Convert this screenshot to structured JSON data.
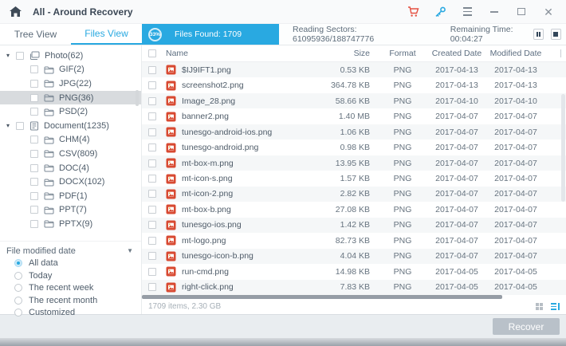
{
  "window": {
    "title": "All - Around Recovery"
  },
  "tabs": {
    "tree": "Tree View",
    "files": "Files View"
  },
  "progress": {
    "percent": "33%",
    "files_found": "Files Found: 1709",
    "reading_sectors": "Reading Sectors: 61095936/188747776",
    "remaining_time": "Remaining Time: 00:04:27"
  },
  "sidebar": {
    "tree": [
      {
        "label": "Photo(62)",
        "icon": "photo",
        "level": 0,
        "expanded": true,
        "selected": false
      },
      {
        "label": "GIF(2)",
        "icon": "folder",
        "level": 1,
        "selected": false
      },
      {
        "label": "JPG(22)",
        "icon": "folder",
        "level": 1,
        "selected": false
      },
      {
        "label": "PNG(36)",
        "icon": "folder",
        "level": 1,
        "selected": true
      },
      {
        "label": "PSD(2)",
        "icon": "folder",
        "level": 1,
        "selected": false
      },
      {
        "label": "Document(1235)",
        "icon": "document",
        "level": 0,
        "expanded": true,
        "selected": false
      },
      {
        "label": "CHM(4)",
        "icon": "folder",
        "level": 1,
        "selected": false
      },
      {
        "label": "CSV(809)",
        "icon": "folder",
        "level": 1,
        "selected": false
      },
      {
        "label": "DOC(4)",
        "icon": "folder",
        "level": 1,
        "selected": false
      },
      {
        "label": "DOCX(102)",
        "icon": "folder",
        "level": 1,
        "selected": false
      },
      {
        "label": "PDF(1)",
        "icon": "folder",
        "level": 1,
        "selected": false
      },
      {
        "label": "PPT(7)",
        "icon": "folder",
        "level": 1,
        "selected": false
      },
      {
        "label": "PPTX(9)",
        "icon": "folder",
        "level": 1,
        "selected": false
      }
    ],
    "filter": {
      "title": "File modified date",
      "options": [
        {
          "label": "All data",
          "selected": true
        },
        {
          "label": "Today",
          "selected": false
        },
        {
          "label": "The recent week",
          "selected": false
        },
        {
          "label": "The recent month",
          "selected": false
        },
        {
          "label": "Customized",
          "selected": false
        }
      ]
    }
  },
  "table": {
    "columns": [
      "Name",
      "Size",
      "Format",
      "Created Date",
      "Modified Date"
    ],
    "rows": [
      {
        "name": "$IJ9IFT1.png",
        "size": "0.53 KB",
        "format": "PNG",
        "created": "2017-04-13",
        "modified": "2017-04-13"
      },
      {
        "name": "screenshot2.png",
        "size": "364.78 KB",
        "format": "PNG",
        "created": "2017-04-13",
        "modified": "2017-04-13"
      },
      {
        "name": "Image_28.png",
        "size": "58.66 KB",
        "format": "PNG",
        "created": "2017-04-10",
        "modified": "2017-04-10"
      },
      {
        "name": "banner2.png",
        "size": "1.40 MB",
        "format": "PNG",
        "created": "2017-04-07",
        "modified": "2017-04-07"
      },
      {
        "name": "tunesgo-android-ios.png",
        "size": "1.06 KB",
        "format": "PNG",
        "created": "2017-04-07",
        "modified": "2017-04-07"
      },
      {
        "name": "tunesgo-android.png",
        "size": "0.98 KB",
        "format": "PNG",
        "created": "2017-04-07",
        "modified": "2017-04-07"
      },
      {
        "name": "mt-box-m.png",
        "size": "13.95 KB",
        "format": "PNG",
        "created": "2017-04-07",
        "modified": "2017-04-07"
      },
      {
        "name": "mt-icon-s.png",
        "size": "1.57 KB",
        "format": "PNG",
        "created": "2017-04-07",
        "modified": "2017-04-07"
      },
      {
        "name": "mt-icon-2.png",
        "size": "2.82 KB",
        "format": "PNG",
        "created": "2017-04-07",
        "modified": "2017-04-07"
      },
      {
        "name": "mt-box-b.png",
        "size": "27.08 KB",
        "format": "PNG",
        "created": "2017-04-07",
        "modified": "2017-04-07"
      },
      {
        "name": "tunesgo-ios.png",
        "size": "1.42 KB",
        "format": "PNG",
        "created": "2017-04-07",
        "modified": "2017-04-07"
      },
      {
        "name": "mt-logo.png",
        "size": "82.73 KB",
        "format": "PNG",
        "created": "2017-04-07",
        "modified": "2017-04-07"
      },
      {
        "name": "tunesgo-icon-b.png",
        "size": "4.04 KB",
        "format": "PNG",
        "created": "2017-04-07",
        "modified": "2017-04-07"
      },
      {
        "name": "run-cmd.png",
        "size": "14.98 KB",
        "format": "PNG",
        "created": "2017-04-05",
        "modified": "2017-04-05"
      },
      {
        "name": "right-click.png",
        "size": "7.83 KB",
        "format": "PNG",
        "created": "2017-04-05",
        "modified": "2017-04-05"
      }
    ]
  },
  "status": {
    "summary": "1709 items, 2.30 GB"
  },
  "footer": {
    "recover_label": "Recover"
  },
  "colors": {
    "accent": "#29a9e1",
    "cart_red": "#e55041",
    "file_icon_red": "#d84a32",
    "selected_row": "#d8dbde"
  }
}
